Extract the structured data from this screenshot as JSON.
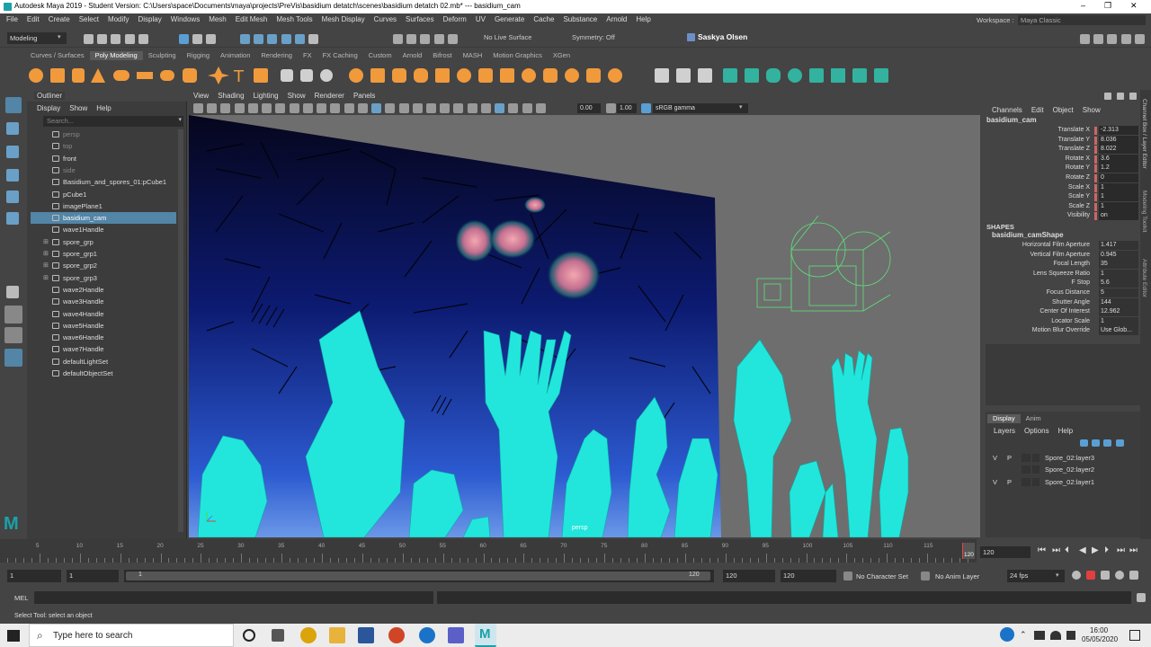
{
  "titlebar": {
    "title": "Autodesk Maya 2019 - Student Version: C:\\Users\\space\\Documents\\maya\\projects\\PreVis\\basidium detatch\\scenes\\basidium detatch 02.mb*  ---  basidium_cam",
    "minimize": "–",
    "maximize": "❐",
    "close": "✕"
  },
  "menubar": {
    "items": [
      "File",
      "Edit",
      "Create",
      "Select",
      "Modify",
      "Display",
      "Windows",
      "Mesh",
      "Edit Mesh",
      "Mesh Tools",
      "Mesh Display",
      "Curves",
      "Surfaces",
      "Deform",
      "UV",
      "Generate",
      "Cache",
      "Substance",
      "Arnold",
      "Help"
    ],
    "workspace_label": "Workspace :",
    "workspace_value": "Maya Classic"
  },
  "statusline": {
    "mode": "Modeling",
    "live_surface": "No Live Surface",
    "symmetry": "Symmetry: Off",
    "user": "Saskya Olsen"
  },
  "shelf": {
    "tabs": [
      "Curves / Surfaces",
      "Poly Modeling",
      "Sculpting",
      "Rigging",
      "Animation",
      "Rendering",
      "FX",
      "FX Caching",
      "Custom",
      "Arnold",
      "Bifrost",
      "MASH",
      "Motion Graphics",
      "XGen"
    ],
    "active": "Poly Modeling"
  },
  "outliner": {
    "title": "Outliner",
    "menu": [
      "Display",
      "Show",
      "Help"
    ],
    "search_placeholder": "Search...",
    "items": [
      {
        "label": "persp",
        "dim": true,
        "expand": ""
      },
      {
        "label": "top",
        "dim": true,
        "expand": ""
      },
      {
        "label": "front",
        "dim": false,
        "expand": ""
      },
      {
        "label": "side",
        "dim": true,
        "expand": ""
      },
      {
        "label": "Basidium_and_spores_01:pCube1",
        "dim": false,
        "expand": ""
      },
      {
        "label": "pCube1",
        "dim": false,
        "expand": ""
      },
      {
        "label": "imagePlane1",
        "dim": false,
        "expand": ""
      },
      {
        "label": "basidium_cam",
        "dim": false,
        "expand": "",
        "selected": true
      },
      {
        "label": "wave1Handle",
        "dim": false,
        "expand": ""
      },
      {
        "label": "spore_grp",
        "dim": false,
        "expand": "⊞"
      },
      {
        "label": "spore_grp1",
        "dim": false,
        "expand": "⊞"
      },
      {
        "label": "spore_grp2",
        "dim": false,
        "expand": "⊞"
      },
      {
        "label": "spore_grp3",
        "dim": false,
        "expand": "⊞"
      },
      {
        "label": "wave2Handle",
        "dim": false,
        "expand": ""
      },
      {
        "label": "wave3Handle",
        "dim": false,
        "expand": ""
      },
      {
        "label": "wave4Handle",
        "dim": false,
        "expand": ""
      },
      {
        "label": "wave5Handle",
        "dim": false,
        "expand": ""
      },
      {
        "label": "wave6Handle",
        "dim": false,
        "expand": ""
      },
      {
        "label": "wave7Handle",
        "dim": false,
        "expand": ""
      },
      {
        "label": "defaultLightSet",
        "dim": false,
        "expand": ""
      },
      {
        "label": "defaultObjectSet",
        "dim": false,
        "expand": ""
      }
    ]
  },
  "viewport": {
    "menu": [
      "View",
      "Shading",
      "Lighting",
      "Show",
      "Renderer",
      "Panels"
    ],
    "exposure": "0.00",
    "gamma": "1.00",
    "colorspace": "sRGB gamma",
    "camera_label": "persp"
  },
  "channelbox": {
    "menu": [
      "Channels",
      "Edit",
      "Object",
      "Show"
    ],
    "object": "basidium_cam",
    "attrs": [
      {
        "name": "Translate X",
        "value": "-2.313"
      },
      {
        "name": "Translate Y",
        "value": "8.036"
      },
      {
        "name": "Translate Z",
        "value": "8.022"
      },
      {
        "name": "Rotate X",
        "value": "3.6"
      },
      {
        "name": "Rotate Y",
        "value": "1.2"
      },
      {
        "name": "Rotate Z",
        "value": "0"
      },
      {
        "name": "Scale X",
        "value": "1"
      },
      {
        "name": "Scale Y",
        "value": "1"
      },
      {
        "name": "Scale Z",
        "value": "1"
      },
      {
        "name": "Visibility",
        "value": "on"
      }
    ],
    "shapes_header": "SHAPES",
    "shape_name": "basidium_camShape",
    "shape_attrs": [
      {
        "name": "Horizontal Film Aperture",
        "value": "1.417"
      },
      {
        "name": "Vertical Film Aperture",
        "value": "0.945"
      },
      {
        "name": "Focal Length",
        "value": "35"
      },
      {
        "name": "Lens Squeeze Ratio",
        "value": "1"
      },
      {
        "name": "F Stop",
        "value": "5.6"
      },
      {
        "name": "Focus Distance",
        "value": "5"
      },
      {
        "name": "Shutter Angle",
        "value": "144"
      },
      {
        "name": "Center Of Interest",
        "value": "12.962"
      },
      {
        "name": "Locator Scale",
        "value": "1"
      },
      {
        "name": "Motion Blur Override",
        "value": "Use Glob..."
      }
    ],
    "side_tabs": [
      "Channel Box / Layer Editor",
      "Modeling Toolkit",
      "Attribute Editor"
    ]
  },
  "layers": {
    "tabs": [
      "Display",
      "Anim"
    ],
    "menu": [
      "Layers",
      "Options",
      "Help"
    ],
    "rows": [
      {
        "v": "V",
        "p": "P",
        "name": "Spore_02:layer3"
      },
      {
        "v": "",
        "p": "",
        "name": "Spore_02:layer2"
      },
      {
        "v": "V",
        "p": "P",
        "name": "Spore_02:layer1"
      }
    ]
  },
  "timeline": {
    "ticks": [
      "5",
      "10",
      "15",
      "20",
      "25",
      "30",
      "35",
      "40",
      "45",
      "50",
      "55",
      "60",
      "65",
      "70",
      "75",
      "80",
      "85",
      "90",
      "95",
      "100",
      "105",
      "110",
      "115",
      "120"
    ],
    "current_frame": "120",
    "end_marker": "120"
  },
  "rangebar": {
    "start": "1",
    "playback_start": "1",
    "slider_start": "1",
    "slider_end": "120",
    "end1": "120",
    "end2": "120",
    "character_set": "No Character Set",
    "anim_layer": "No Anim Layer",
    "fps": "24 fps"
  },
  "commandline": {
    "label": "MEL"
  },
  "helpline": {
    "text": "Select Tool: select an object"
  },
  "taskbar": {
    "search_placeholder": "Type here to search",
    "time": "16:00",
    "date": "05/05/2020"
  }
}
